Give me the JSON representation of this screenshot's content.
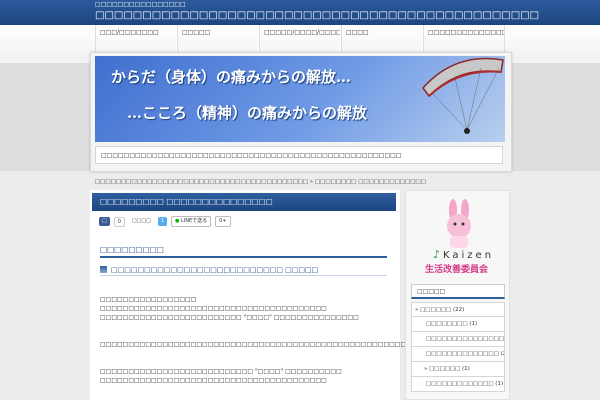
{
  "site": {
    "subtitle": "□□□□□□□□□□□□□□□□",
    "title": "□□□□□□□□□□□□□□□□□□□□□□□□□□□□□□□□□□□□□□□□□□□□□□□"
  },
  "nav": {
    "items": [
      {
        "label": "□□□/□□□□□□□"
      },
      {
        "label": "□□□□□"
      },
      {
        "label": "□□□□□/□□□□/□□□□□□□"
      },
      {
        "label": "□□□□"
      },
      {
        "label": "□□□□□□□□□□□□□□□□□"
      }
    ]
  },
  "banner": {
    "line1": "からだ（身体）の痛みからの解放…",
    "line2": "…こころ（精神）の痛みからの解放"
  },
  "description": "□□□□□□□□□□□□□□□□□□□□□□□□□□□□□□□□□□□□□□□□□□□□□□□□□□□□□",
  "breadcrumb": "□□□□□□□□□□□□□□□□□□□□□□□□□□□□□□□□□□□□□□□□□ » □□□□□□□□ □□□□□□□□□□□□□",
  "post": {
    "title": "□□□□□□□□□ □□□□□□□□□□□□□□□",
    "h2": "□□□□□□□□□",
    "h3": "□□□□□□□□□□□□□□□□□□□□□□□□□□ □□□□□",
    "paragraphs": [
      "□□□□□□□□□□□□□□□□□",
      "□□□□□□□□□□□□□□□□□□□□□□□□□□□□□□□□□□□□□□□□",
      "□□□□□□□□□□□□□□□□□□□□□□□□□ \"□□□□\" □□□□□□□□□□□□□□□",
      "□□□□□□□□□□□□□□□□□□□□□□□□□□□□□□□□□□□□□□□□□□□□□□□□□□□□□□□□□□□□□□",
      "□□□□□□□□□□□□□□□□□□□□□□□□□□□ \"□□□□\" □□□□□□□□□□",
      "□□□□□□□□□□□□□□□□□□□□□□□□□□□□□□□□□□□□□□□□"
    ]
  },
  "share": {
    "fb_count": "0",
    "fb_label": "□",
    "tw_label": "□□□□",
    "tw_count": "1",
    "line_label": "LINEで送る",
    "gplus_label": "0+"
  },
  "sidebar": {
    "logo_text": "Kaizen",
    "logo_sub": "生活改善委員会",
    "heading": "□□□□□",
    "items": [
      {
        "label": "» □□□□□□ (22)"
      },
      {
        "label": "□□□□□□□□ (1)"
      },
      {
        "label": "□□□□□□□□□□□□□□□ (1)"
      },
      {
        "label": "□□□□□□□□□□□□□□ (2)"
      },
      {
        "label": "» □□□□□□ (1)"
      },
      {
        "label": "□□□□□□□□□□□□□ (1)"
      }
    ]
  }
}
